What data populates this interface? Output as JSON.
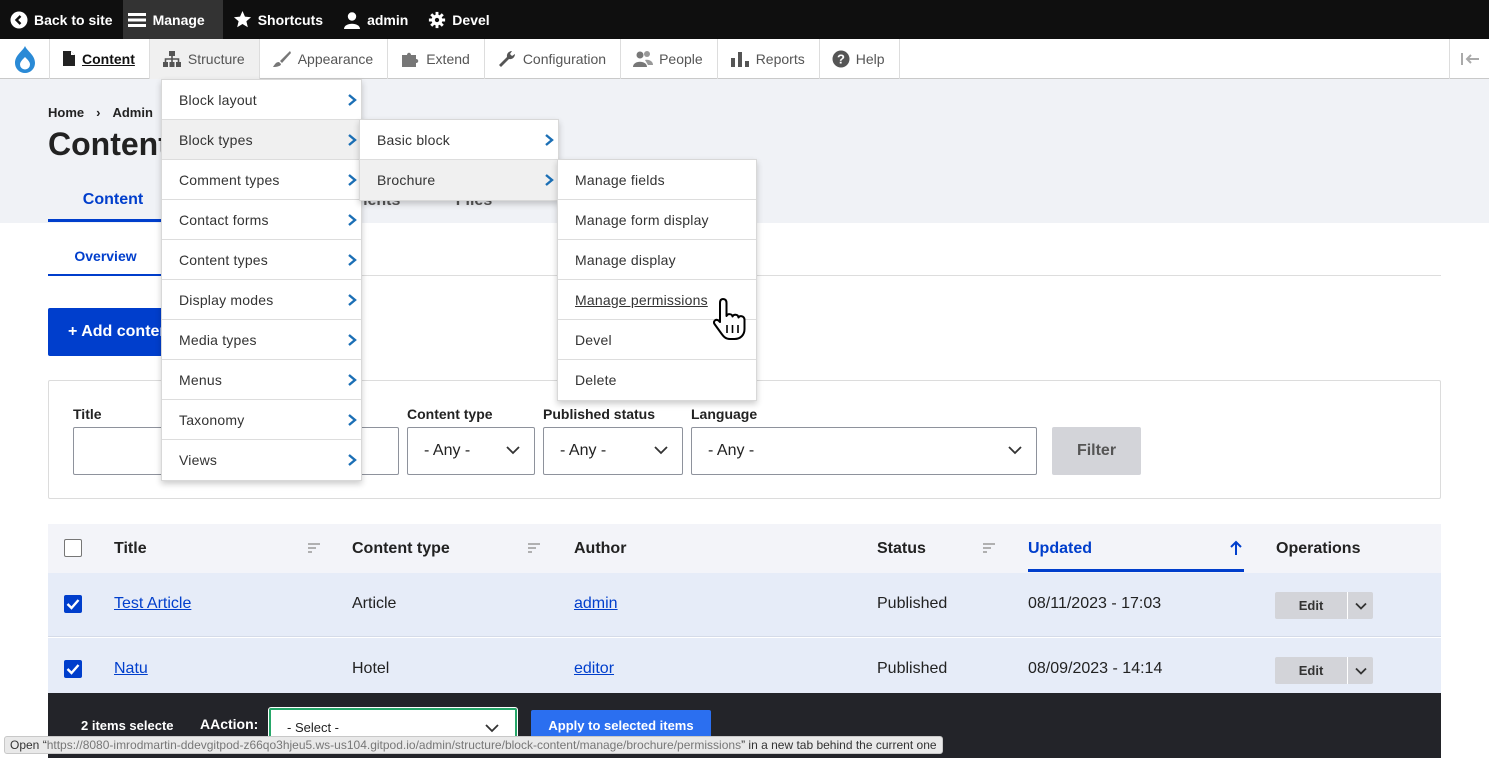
{
  "toolbar": {
    "back": "Back to site",
    "manage": "Manage",
    "shortcuts": "Shortcuts",
    "user": "admin",
    "devel": "Devel"
  },
  "tray": {
    "items": [
      "Content",
      "Structure",
      "Appearance",
      "Extend",
      "Configuration",
      "People",
      "Reports",
      "Help"
    ]
  },
  "breadcrumb": [
    "Home",
    "Admin"
  ],
  "page_title": "Content",
  "tabs": [
    "Content",
    "Comments",
    "Files"
  ],
  "subtabs": [
    "Overview"
  ],
  "add_button": "+ Add content",
  "filters": {
    "title_label": "Title",
    "title_value": "",
    "content_type_label": "Content type",
    "content_type_value": "- Any -",
    "status_label": "Published status",
    "status_value": "- Any -",
    "language_label": "Language",
    "language_value": "- Any -",
    "submit": "Filter"
  },
  "table": {
    "headers": [
      "Title",
      "Content type",
      "Author",
      "Status",
      "Updated",
      "Operations"
    ],
    "rows": [
      {
        "checked": true,
        "title": "Test Article",
        "type": "Article",
        "author": "admin",
        "status": "Published",
        "updated": "08/11/2023 - 17:03",
        "op": "Edit"
      },
      {
        "checked": true,
        "title": "Natu",
        "type": "Hotel",
        "author": "editor",
        "status": "Published",
        "updated": "08/09/2023 - 14:14",
        "op": "Edit"
      }
    ]
  },
  "bulk": {
    "count": "2 items selecte",
    "action_label": "AAction:",
    "select_value": "- Select -",
    "apply": "Apply to selected items"
  },
  "structure_menu": [
    "Block layout",
    "Block types",
    "Comment types",
    "Contact forms",
    "Content types",
    "Display modes",
    "Media types",
    "Menus",
    "Taxonomy",
    "Views"
  ],
  "block_types_menu": [
    "Basic block",
    "Brochure"
  ],
  "brochure_menu": [
    "Manage fields",
    "Manage form display",
    "Manage display",
    "Manage permissions",
    "Devel",
    "Delete"
  ],
  "status_bar": {
    "prefix": "Open “",
    "url": "https://8080-imrodmartin-ddevgitpod-z66qo3hjeu5.ws-us104.gitpod.io/admin/structure/block-content/manage/brochure/permissions",
    "suffix": "” in a new tab behind the current one"
  },
  "colors": {
    "accent": "#003ecc",
    "toolbar": "#0f0f0f",
    "row_selected": "#e6ecf8",
    "bulk_bar": "#232429",
    "apply": "#2b6ff0"
  },
  "icons": [
    "back-arrow-icon",
    "manage-menu-icon",
    "star-icon",
    "user-icon",
    "gear-icon",
    "drupal-drop-icon",
    "content-page-icon",
    "structure-sitemap-icon",
    "appearance-brush-icon",
    "extend-puzzle-icon",
    "configuration-wrench-icon",
    "people-icon",
    "reports-bars-icon",
    "help-icon",
    "collapse-tray-icon",
    "chevron-right-icon",
    "chevron-down-icon",
    "sort-icon",
    "sort-ascending-arrow-icon",
    "checkbox-checked-icon",
    "hand-pointer-cursor-icon"
  ]
}
